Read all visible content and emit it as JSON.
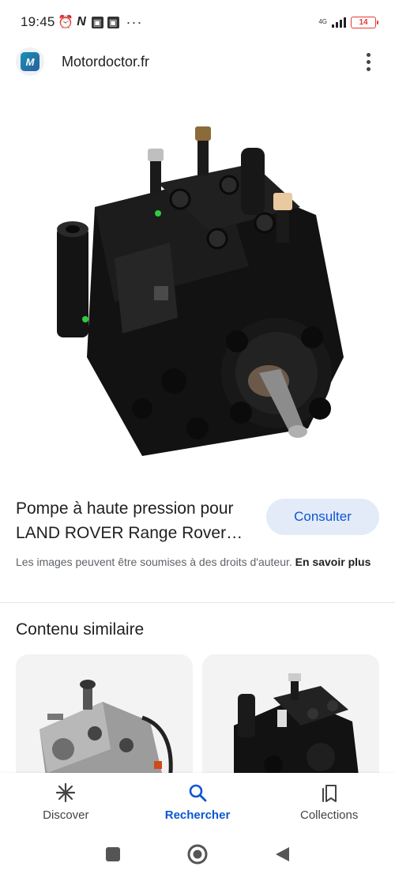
{
  "status_bar": {
    "time": "19:45",
    "network": "4G",
    "battery": "14"
  },
  "header": {
    "favicon_letter": "M",
    "site_name": "Motordoctor.fr"
  },
  "main_image": {
    "icon": "fuel-pump-photo"
  },
  "result": {
    "title": "Pompe à haute pression pour LAND ROVER Range Rover…",
    "consult_label": "Consulter",
    "copyright_text": "Les images peuvent être soumises à des droits d'auteur.",
    "learn_more": "En savoir plus"
  },
  "similar": {
    "heading": "Contenu similaire",
    "cards": [
      {
        "icon": "fuel-pump-photo-silver"
      },
      {
        "icon": "fuel-pump-photo-black"
      }
    ]
  },
  "bottom_nav": {
    "items": [
      {
        "label": "Discover",
        "icon": "asterisk-icon",
        "active": false
      },
      {
        "label": "Rechercher",
        "icon": "search-icon",
        "active": true
      },
      {
        "label": "Collections",
        "icon": "collections-icon",
        "active": false
      }
    ]
  },
  "colors": {
    "accent": "#0b57d0",
    "button_bg": "#e3ebf9",
    "battery_low": "#e53935"
  }
}
